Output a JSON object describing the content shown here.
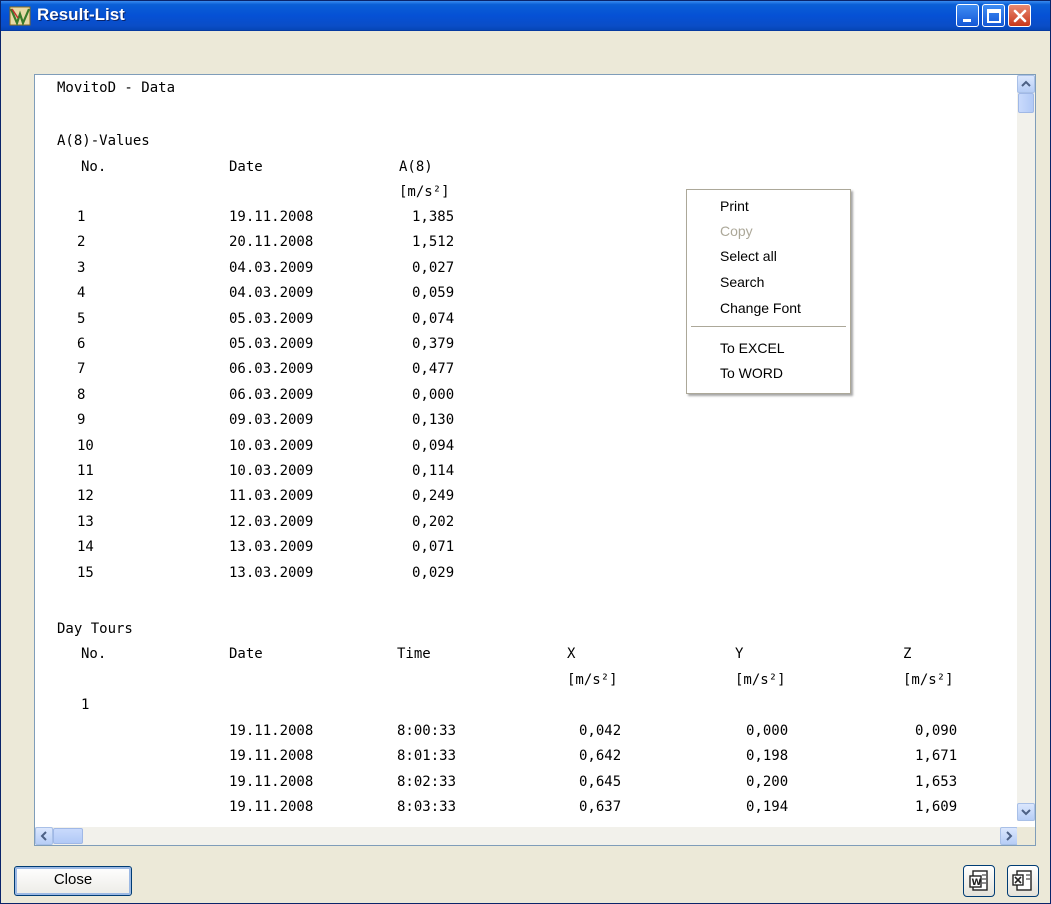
{
  "window": {
    "title": "Result-List"
  },
  "text_lines": {
    "header": "MovitoD - Data",
    "a8_title": "A(8)-Values",
    "a8_col_no": "No.",
    "a8_col_date": "Date",
    "a8_col_value": "A(8)",
    "a8_unit": "[m/s²]",
    "day_title": "Day Tours",
    "day_col_no": "No.",
    "day_col_date": "Date",
    "day_col_time": "Time",
    "day_col_x": "X",
    "day_col_y": "Y",
    "day_col_z": "Z",
    "day_unit_x": "[m/s²]",
    "day_unit_y": "[m/s²]",
    "day_unit_z": "[m/s²]",
    "day_tour_no": "1"
  },
  "a8_rows": [
    {
      "no": "1",
      "date": "19.11.2008",
      "value": "1,385"
    },
    {
      "no": "2",
      "date": "20.11.2008",
      "value": "1,512"
    },
    {
      "no": "3",
      "date": "04.03.2009",
      "value": "0,027"
    },
    {
      "no": "4",
      "date": "04.03.2009",
      "value": "0,059"
    },
    {
      "no": "5",
      "date": "05.03.2009",
      "value": "0,074"
    },
    {
      "no": "6",
      "date": "05.03.2009",
      "value": "0,379"
    },
    {
      "no": "7",
      "date": "06.03.2009",
      "value": "0,477"
    },
    {
      "no": "8",
      "date": "06.03.2009",
      "value": "0,000"
    },
    {
      "no": "9",
      "date": "09.03.2009",
      "value": "0,130"
    },
    {
      "no": "10",
      "date": "10.03.2009",
      "value": "0,094"
    },
    {
      "no": "11",
      "date": "10.03.2009",
      "value": "0,114"
    },
    {
      "no": "12",
      "date": "11.03.2009",
      "value": "0,249"
    },
    {
      "no": "13",
      "date": "12.03.2009",
      "value": "0,202"
    },
    {
      "no": "14",
      "date": "13.03.2009",
      "value": "0,071"
    },
    {
      "no": "15",
      "date": "13.03.2009",
      "value": "0,029"
    }
  ],
  "day_rows": [
    {
      "date": "19.11.2008",
      "time": "8:00:33",
      "x": "0,042",
      "y": "0,000",
      "z": "0,090"
    },
    {
      "date": "19.11.2008",
      "time": "8:01:33",
      "x": "0,642",
      "y": "0,198",
      "z": "1,671"
    },
    {
      "date": "19.11.2008",
      "time": "8:02:33",
      "x": "0,645",
      "y": "0,200",
      "z": "1,653"
    },
    {
      "date": "19.11.2008",
      "time": "8:03:33",
      "x": "0,637",
      "y": "0,194",
      "z": "1,609"
    }
  ],
  "context_menu": {
    "print": "Print",
    "copy": "Copy",
    "select_all": "Select all",
    "search": "Search",
    "change_font": "Change Font",
    "to_excel": "To EXCEL",
    "to_word": "To WORD"
  },
  "footer": {
    "close_label": "Close"
  },
  "icons": {
    "minimize": "minimize-icon",
    "maximize": "maximize-icon",
    "close": "close-icon",
    "export_word": "word-export-icon",
    "export_excel": "excel-export-icon"
  },
  "colors": {
    "titlebar": "#0551d5",
    "window_bg": "#ece9d8",
    "menu_disabled": "#aca899"
  }
}
